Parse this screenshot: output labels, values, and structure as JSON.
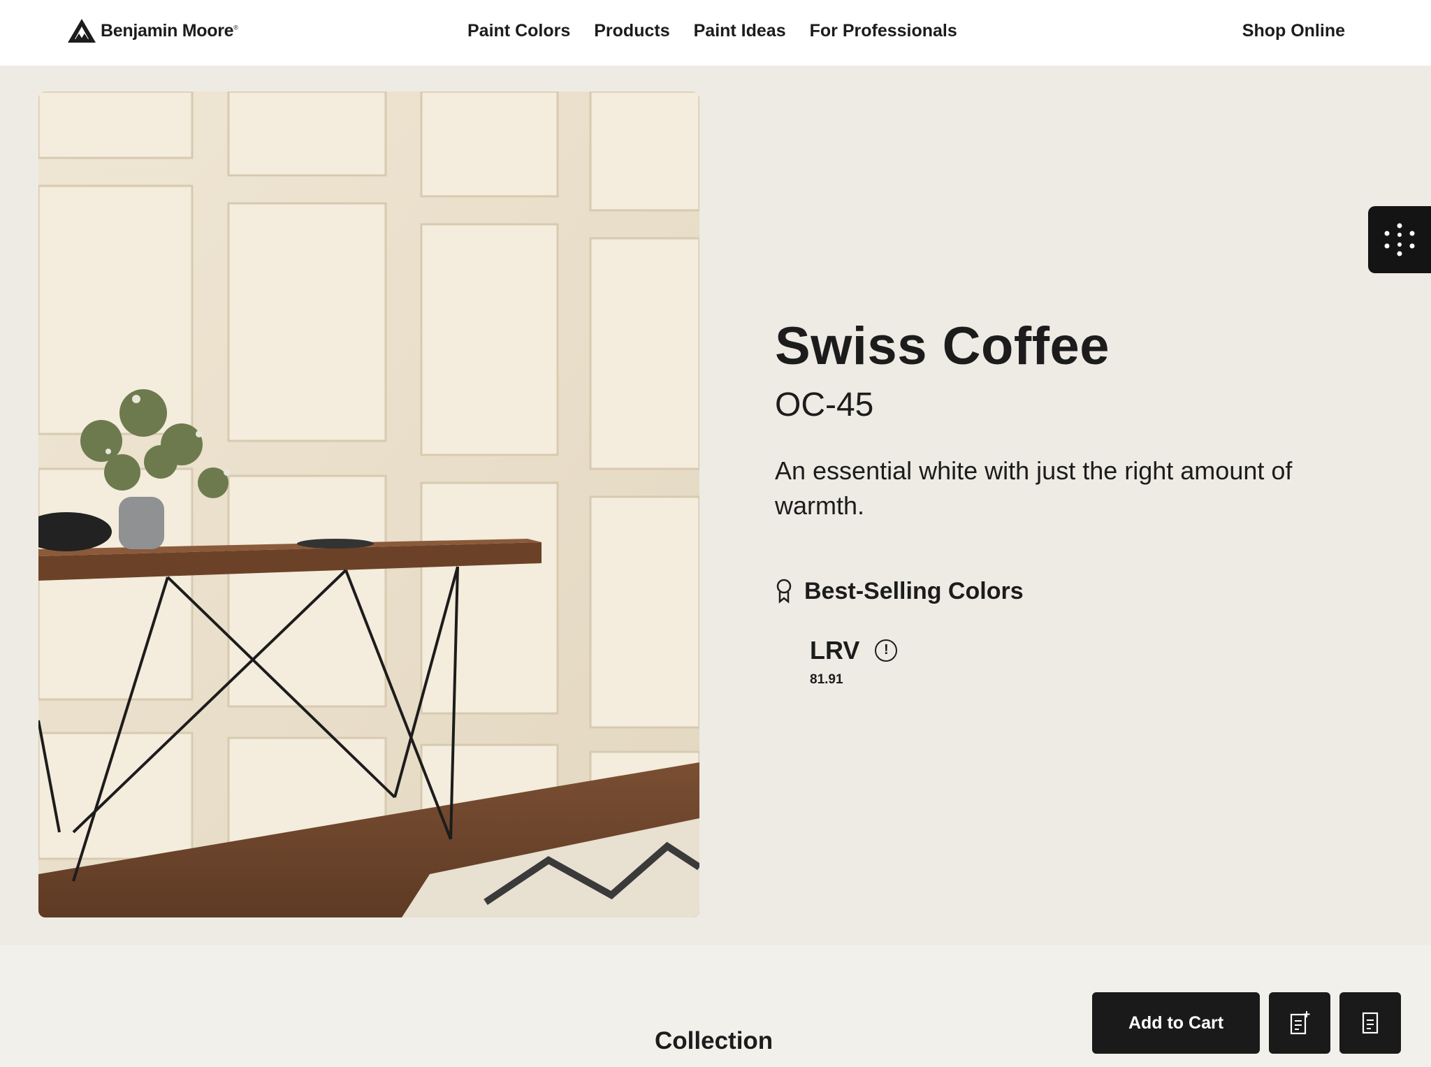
{
  "header": {
    "logo_text": "Benjamin Moore",
    "nav": [
      {
        "label": "Paint Colors"
      },
      {
        "label": "Products"
      },
      {
        "label": "Paint Ideas"
      },
      {
        "label": "For Professionals"
      }
    ],
    "shop_online": "Shop Online"
  },
  "color": {
    "name": "Swiss Coffee",
    "code": "OC-45",
    "description": "An essential white with just the right amount of warmth.",
    "badge": "Best-Selling Colors",
    "lrv_label": "LRV",
    "lrv_value": "81.91",
    "swatch_hex": "#ede4d2"
  },
  "bottom": {
    "collection_heading": "Collection",
    "add_to_cart": "Add to Cart"
  },
  "icons": {
    "logo": "benjamin-moore-triangle-icon",
    "badge": "award-ribbon-icon",
    "info": "info-icon",
    "widget": "dots-circle-icon",
    "add_list": "add-to-list-icon",
    "list": "list-icon"
  }
}
